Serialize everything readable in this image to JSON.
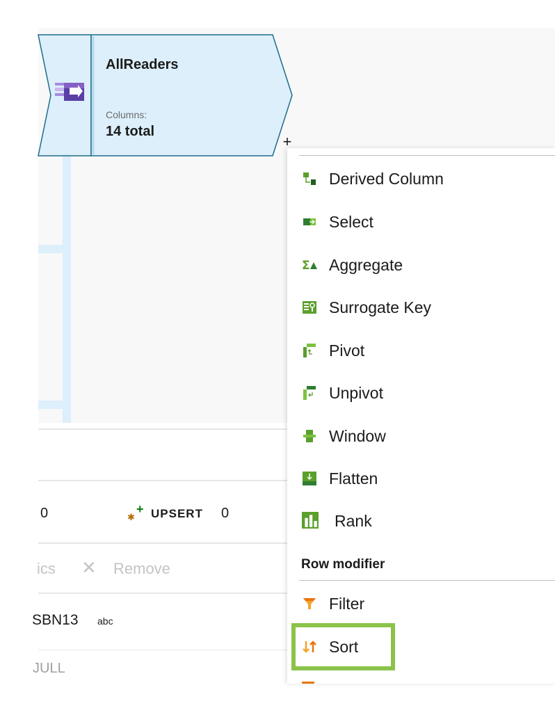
{
  "node": {
    "title": "AllReaders",
    "columns_label": "Columns:",
    "columns_value": "14 total",
    "add_symbol": "+"
  },
  "stats": {
    "prev_count": "0",
    "upsert_label": "UPSERT",
    "upsert_count": "0"
  },
  "toolbar": {
    "stats_label": "ics",
    "remove_label": "Remove"
  },
  "columns": {
    "name": "SBN13",
    "type": "abc",
    "value": "JULL"
  },
  "menu": {
    "items": [
      {
        "label": "Derived Column",
        "icon": "derived-column-icon"
      },
      {
        "label": "Select",
        "icon": "select-icon"
      },
      {
        "label": "Aggregate",
        "icon": "aggregate-icon"
      },
      {
        "label": "Surrogate Key",
        "icon": "surrogate-key-icon"
      },
      {
        "label": "Pivot",
        "icon": "pivot-icon"
      },
      {
        "label": "Unpivot",
        "icon": "unpivot-icon"
      },
      {
        "label": "Window",
        "icon": "window-icon"
      },
      {
        "label": "Flatten",
        "icon": "flatten-icon"
      },
      {
        "label": "Rank",
        "icon": "rank-icon"
      }
    ],
    "section_row_modifier": "Row modifier",
    "row_modifier_items": [
      {
        "label": "Filter",
        "icon": "filter-icon"
      },
      {
        "label": "Sort",
        "icon": "sort-icon"
      }
    ]
  },
  "colors": {
    "node_fill": "#dceffb",
    "node_stroke": "#1f6c8a",
    "join_icon": "#8661c5",
    "highlight": "#8bc34a",
    "green_icon": "#5b9f2c",
    "sort_orange": "#e8750e"
  }
}
